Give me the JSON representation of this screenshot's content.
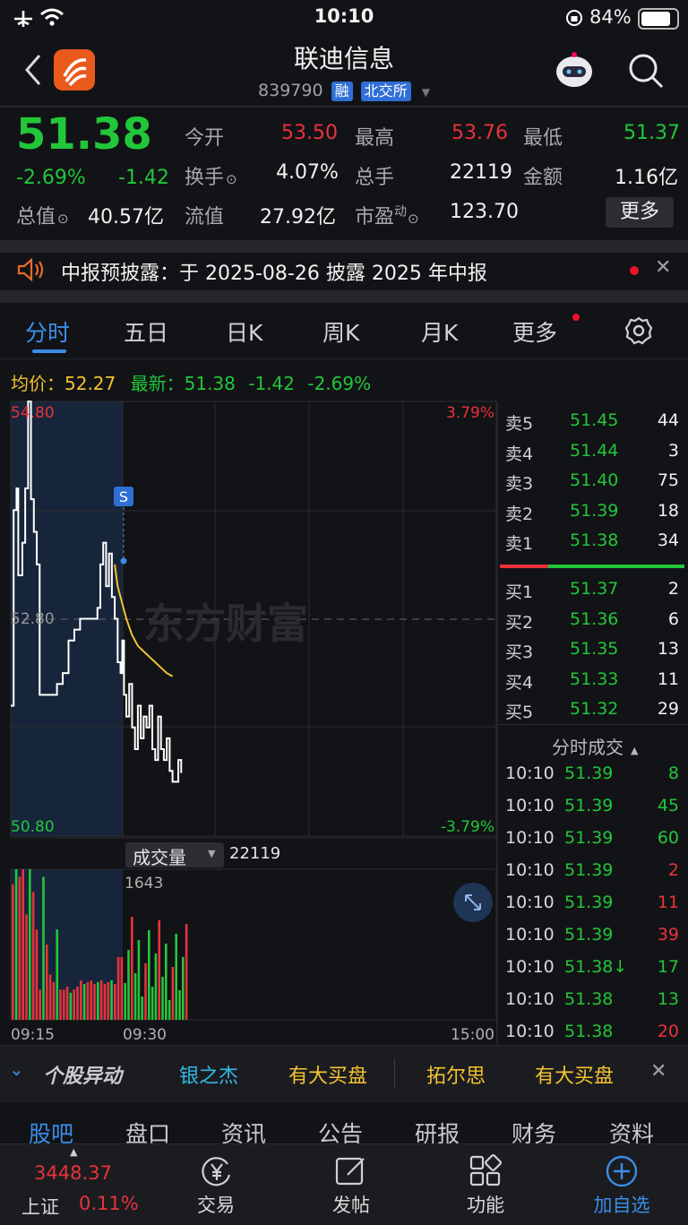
{
  "status_bar": {
    "time": "10:10",
    "battery": "84%"
  },
  "header": {
    "title": "联迪信息",
    "code": "839790",
    "tag_margin": "融",
    "tag_exchange": "北交所"
  },
  "quote": {
    "price": "51.38",
    "change_pct": "-2.69%",
    "change": "-1.42",
    "open_label": "今开",
    "open": "53.50",
    "high_label": "最高",
    "high": "53.76",
    "low_label": "最低",
    "low": "51.37",
    "turnover_label": "换手",
    "turnover": "4.07%",
    "volume_label": "总手",
    "volume": "22119",
    "amount_label": "金额",
    "amount": "1.16亿",
    "mktcap_label": "总值",
    "mktcap": "40.57亿",
    "float_label": "流值",
    "float_cap": "27.92亿",
    "pe_label": "市盈",
    "pe_sup": "动",
    "pe": "123.70",
    "more_label": "更多"
  },
  "notice": {
    "text": "中报预披露：于 2025-08-26 披露 2025 年中报"
  },
  "tabs": [
    "分时",
    "五日",
    "日K",
    "周K",
    "月K",
    "更多"
  ],
  "info_line": {
    "avg_label": "均价：",
    "avg": "52.27",
    "latest_label": "最新：",
    "latest": "51.38",
    "change": "-1.42",
    "change_pct": "-2.69%"
  },
  "chart_data": {
    "type": "line",
    "title": "",
    "ylim": [
      50.8,
      54.8
    ],
    "y_top_label": "54.80",
    "y_mid_label": "52.80",
    "y_bottom_label": "50.80",
    "pct_top_label": "3.79%",
    "pct_bottom_label": "-3.79%",
    "x_labels": [
      "09:15",
      "09:30",
      "15:00"
    ],
    "signal_label": "S",
    "watermark": "东方财富",
    "series": [
      {
        "name": "",
        "color": "#ffffff",
        "x": [
          0,
          0.5,
          1,
          1.3,
          2,
          2.5,
          3,
          3.5,
          4,
          4.5,
          5,
          6,
          7,
          8,
          9,
          10,
          11,
          12,
          13,
          14,
          15,
          15.5,
          16,
          16.5,
          17,
          17.5,
          18,
          18.5,
          19,
          19.3,
          19.6,
          20,
          20.5,
          21,
          21.5,
          22,
          22.5,
          23,
          23.5,
          24,
          24.5,
          25,
          25.5,
          26,
          26.5,
          27,
          27.5,
          28,
          28.5,
          29,
          29.5
        ],
        "values": [
          52.0,
          53.8,
          54.0,
          53.2,
          53.5,
          54.0,
          54.8,
          53.9,
          53.6,
          53.3,
          52.1,
          52.1,
          52.1,
          52.2,
          52.3,
          52.6,
          52.7,
          52.8,
          52.8,
          52.8,
          52.9,
          53.3,
          53.5,
          53.1,
          53.4,
          53.0,
          52.8,
          52.4,
          52.3,
          52.6,
          52.1,
          51.9,
          52.2,
          51.8,
          51.6,
          52.0,
          51.7,
          51.9,
          51.8,
          52.0,
          51.6,
          51.5,
          51.9,
          51.6,
          51.5,
          51.7,
          51.4,
          51.3,
          51.3,
          51.5,
          51.38
        ]
      },
      {
        "name": "",
        "color": "#f2c230",
        "x": [
          18,
          18.5,
          19,
          20,
          21,
          22,
          23,
          24,
          25,
          26,
          27,
          28
        ],
        "values": [
          53.3,
          53.1,
          53.0,
          52.8,
          52.65,
          52.55,
          52.5,
          52.45,
          52.4,
          52.35,
          52.3,
          52.27
        ]
      }
    ]
  },
  "volume_panel": {
    "label": "成交量",
    "total": "22119",
    "peak_label": "1643"
  },
  "orderbook": {
    "asks": [
      {
        "label": "卖5",
        "price": "51.45",
        "qty": "44"
      },
      {
        "label": "卖4",
        "price": "51.44",
        "qty": "3"
      },
      {
        "label": "卖3",
        "price": "51.40",
        "qty": "75"
      },
      {
        "label": "卖2",
        "price": "51.39",
        "qty": "18"
      },
      {
        "label": "卖1",
        "price": "51.38",
        "qty": "34"
      }
    ],
    "bids": [
      {
        "label": "买1",
        "price": "51.37",
        "qty": "2"
      },
      {
        "label": "买2",
        "price": "51.36",
        "qty": "6"
      },
      {
        "label": "买3",
        "price": "51.35",
        "qty": "13"
      },
      {
        "label": "买4",
        "price": "51.33",
        "qty": "11"
      },
      {
        "label": "买5",
        "price": "51.32",
        "qty": "29"
      }
    ],
    "buy_ratio": 0.26
  },
  "trades": {
    "header": "分时成交",
    "rows": [
      {
        "time": "10:10",
        "price": "51.39",
        "qty": "8",
        "qcolor": "green"
      },
      {
        "time": "10:10",
        "price": "51.39",
        "qty": "45",
        "qcolor": "green"
      },
      {
        "time": "10:10",
        "price": "51.39",
        "qty": "60",
        "qcolor": "green"
      },
      {
        "time": "10:10",
        "price": "51.39",
        "qty": "2",
        "qcolor": "red"
      },
      {
        "time": "10:10",
        "price": "51.39",
        "qty": "11",
        "qcolor": "red"
      },
      {
        "time": "10:10",
        "price": "51.39",
        "qty": "39",
        "qcolor": "red"
      },
      {
        "time": "10:10",
        "price": "51.38↓",
        "qty": "17",
        "qcolor": "green"
      },
      {
        "time": "10:10",
        "price": "51.38",
        "qty": "13",
        "qcolor": "green"
      },
      {
        "time": "10:10",
        "price": "51.38",
        "qty": "20",
        "qcolor": "red"
      }
    ]
  },
  "ticker": {
    "title": "个股异动",
    "items": [
      {
        "text": "银之杰",
        "color": "#33b8e6"
      },
      {
        "text": "有大买盘",
        "color": "#f2c230"
      },
      {
        "text": "拓尔思",
        "color": "#f2c230"
      },
      {
        "text": "有大买盘",
        "color": "#f2c230"
      }
    ]
  },
  "subtabs": [
    "股吧",
    "盘口",
    "资讯",
    "公告",
    "研报",
    "财务",
    "资料"
  ],
  "bottom_bar": {
    "index_value": "3448.37",
    "index_name": "上证",
    "index_change": "0.11%",
    "items": [
      "交易",
      "发帖",
      "功能",
      "加自选"
    ]
  }
}
